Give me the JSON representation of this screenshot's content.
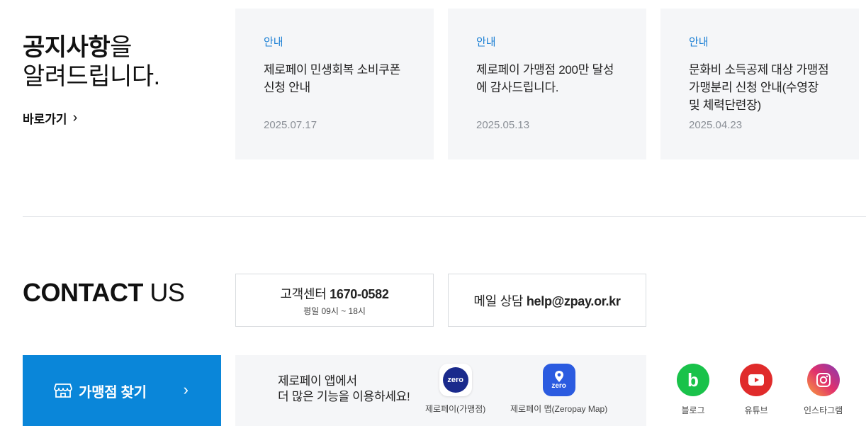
{
  "notice": {
    "title_bold": "공지사항",
    "title_tail": "을",
    "subtitle": "알려드립니다.",
    "goto_label": "바로가기",
    "cards": [
      {
        "category": "안내",
        "title": "제로페이 민생회복 소비쿠폰 신청 안내",
        "date": "2025.07.17"
      },
      {
        "category": "안내",
        "title": "제로페이 가맹점 200만 달성에 감사드립니다.",
        "date": "2025.05.13"
      },
      {
        "category": "안내",
        "title": "문화비 소득공제 대상 가맹점 가맹분리 신청 안내(수영장 및 체력단련장)",
        "date": "2025.04.23"
      }
    ]
  },
  "contact": {
    "title_bold": "CONTACT",
    "title_thin": " US",
    "call": {
      "label": "고객센터 ",
      "number": "1670-0582",
      "hours": "평일 09시 ~ 18시"
    },
    "mail": {
      "label": "메일 상담 ",
      "address": "help@zpay.or.kr"
    }
  },
  "finder": {
    "label": "가맹점 찾기",
    "icon": "store-icon"
  },
  "app_promo": {
    "line1": "제로페이 앱에서",
    "line2": "더 많은 기능을 이용하세요!",
    "apps": [
      {
        "label": "제로페이(가맹점)",
        "icon_text": "zero",
        "color": "#1a2a8c"
      },
      {
        "label": "제로페이 맵(Zeropay Map)",
        "icon_text": "zero",
        "color": "#2b5be0"
      }
    ]
  },
  "sns": [
    {
      "label": "블로그",
      "icon": "blog-icon",
      "color": "#19c24a"
    },
    {
      "label": "유튜브",
      "icon": "youtube-icon",
      "color": "#e02b2b"
    },
    {
      "label": "인스타그램",
      "icon": "instagram-icon",
      "color": "#c13584"
    }
  ]
}
